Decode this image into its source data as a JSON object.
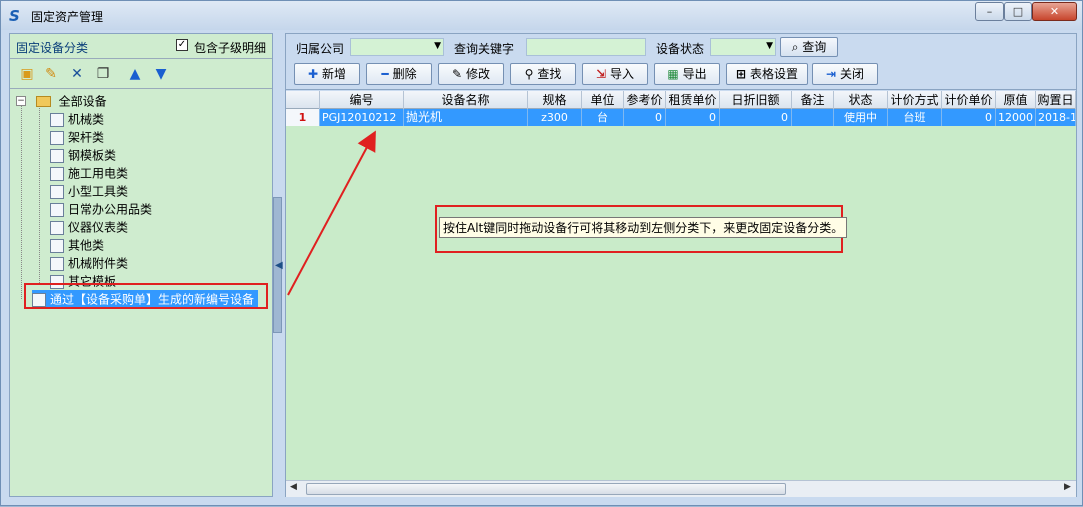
{
  "window": {
    "title": "固定资产管理",
    "min_glyph": "–",
    "max_glyph": "□",
    "close_glyph": "✕"
  },
  "left": {
    "header_title": "固定设备分类",
    "include_children_label": "包含子级明细",
    "include_children_checked": true,
    "check_glyph": "✓",
    "toolbar": [
      "add-folder-icon",
      "edit-icon",
      "delete-icon",
      "copy-icon",
      "arrow-up-icon",
      "arrow-down-icon"
    ],
    "tree": {
      "root": "全部设备",
      "expander": "−",
      "children": [
        "机械类",
        "架杆类",
        "钢模板类",
        "施工用电类",
        "小型工具类",
        "日常办公用品类",
        "仪器仪表类",
        "其他类",
        "机械附件类",
        "其它模板"
      ],
      "extra": "通过【设备采购单】生成的新编号设备"
    }
  },
  "right": {
    "filter": {
      "company_label": "归属公司",
      "company_value": "",
      "keyword_label": "查询关键字",
      "keyword_value": "",
      "status_label": "设备状态",
      "status_value": "",
      "query_button": "查询"
    },
    "buttons": [
      "新增",
      "删除",
      "修改",
      "查找",
      "导入",
      "导出",
      "表格设置",
      "关闭"
    ],
    "columns": [
      "编号",
      "设备名称",
      "规格",
      "单位",
      "参考价",
      "租赁单价",
      "日折旧额",
      "备注",
      "状态",
      "计价方式",
      "计价单价",
      "原值",
      "购置日"
    ],
    "rows": [
      {
        "index": "1",
        "code": "PGJ12010212",
        "name": "抛光机",
        "spec": "z300",
        "unit": "台",
        "ref_price": "0",
        "rent_price": "0",
        "daily_dep": "0",
        "remark": "",
        "status": "使用中",
        "pricing": "台班",
        "unit_price": "0",
        "original": "12000",
        "purchase_date": "2018-1"
      }
    ],
    "tooltip": "按住Alt键同时拖动设备行可将其移动到左侧分类下，来更改固定设备分类。"
  },
  "colors": {
    "panel_green": "#cfeccf",
    "selection_blue": "#3399ff",
    "annotation_red": "#e02020"
  }
}
